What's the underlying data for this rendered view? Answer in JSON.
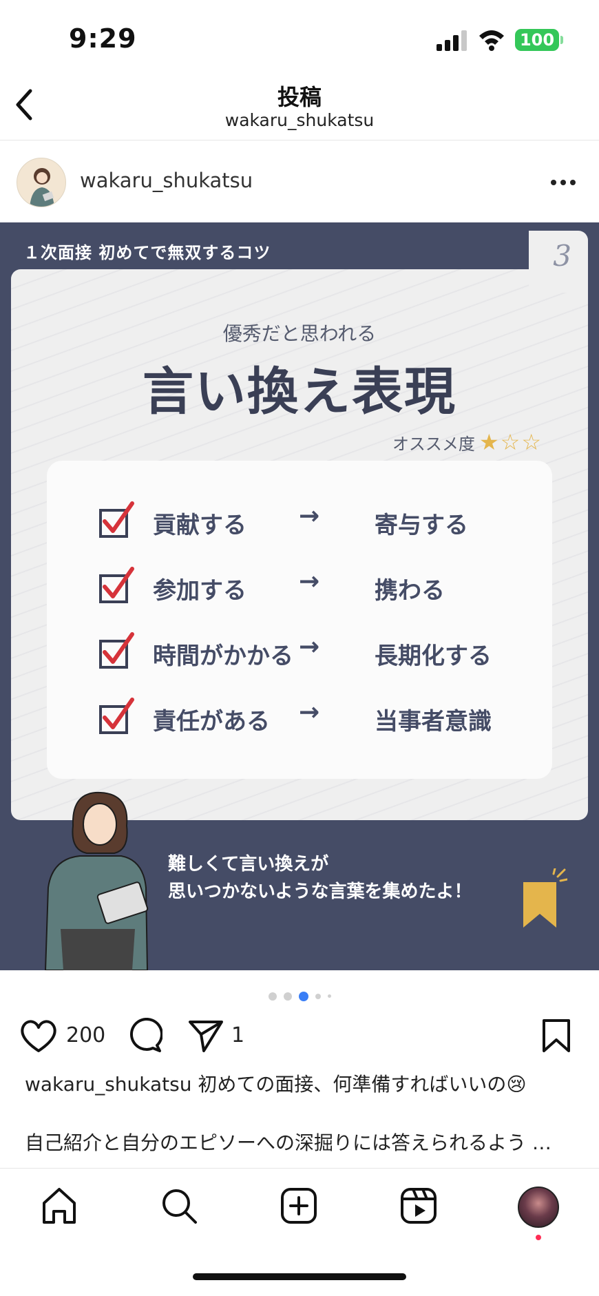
{
  "status": {
    "time": "9:29",
    "battery": "100"
  },
  "header": {
    "title": "投稿",
    "subtitle": "wakaru_shukatsu"
  },
  "post": {
    "username": "wakaru_shukatsu",
    "image": {
      "tag": "１次面接 初めてで無双するコツ",
      "page_number": "3",
      "subtitle": "優秀だと思われる",
      "title": "言い換え表現",
      "recommend_label": "オススメ度",
      "recommend_stars": "★☆☆",
      "rows": [
        {
          "from": "貢献する",
          "arrow": "→",
          "to": "寄与する"
        },
        {
          "from": "参加する",
          "arrow": "→",
          "to": "携わる"
        },
        {
          "from": "時間がかかる",
          "arrow": "→",
          "to": "長期化する"
        },
        {
          "from": "責任がある",
          "arrow": "→",
          "to": "当事者意識"
        }
      ],
      "message_line1": "難しくて言い換えが",
      "message_line2": "思いつかないような言葉を集めたよ！"
    },
    "likes": "200",
    "shares": "1",
    "caption_user": "wakaru_shukatsu",
    "caption_text": "初めての面接、何準備すればいいの😢",
    "caption_more": "自己紹介と自分のエピソーへの深掘りには答えられるよう …"
  },
  "colors": {
    "accent": "#3a7ef6",
    "navy": "#454c66",
    "battery": "#34c759",
    "star": "#e4b54c"
  }
}
